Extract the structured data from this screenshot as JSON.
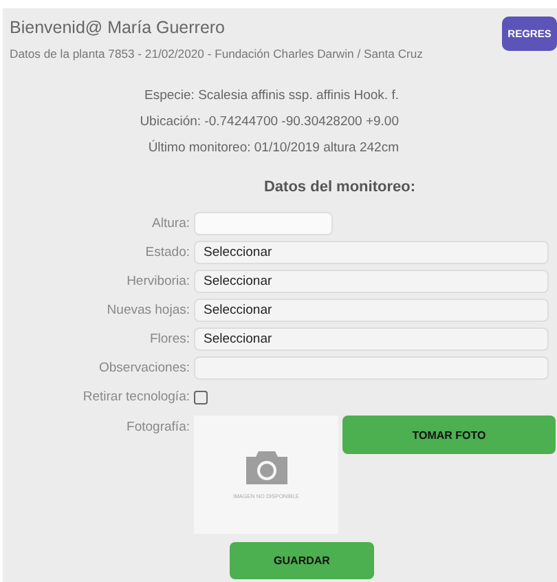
{
  "header": {
    "greeting": "Bienvenid@ María Guerrero",
    "subtitle": "Datos de la planta 7853 - 21/02/2020 - Fundación Charles Darwin / Santa Cruz",
    "back_button": "REGRES"
  },
  "plant_info": [
    "Especie: Scalesia affinis ssp. affinis Hook. f.",
    "Ubicación: -0.74244700 -90.30428200 +9.00",
    "Último monitoreo: 01/10/2019 altura 242cm"
  ],
  "section_title": "Datos del monitoreo:",
  "fields": [
    {
      "label": "Altura:",
      "kind": "text"
    },
    {
      "label": "Estado:",
      "kind": "select",
      "value": "Seleccionar"
    },
    {
      "label": "Herviboria:",
      "kind": "select",
      "value": "Seleccionar"
    },
    {
      "label": "Nuevas hojas:",
      "kind": "select",
      "value": "Seleccionar"
    },
    {
      "label": "Flores:",
      "kind": "select",
      "value": "Seleccionar"
    },
    {
      "label": "Observaciones:",
      "kind": "wide"
    },
    {
      "label": "Retirar tecnología:",
      "kind": "checkbox",
      "checked": false
    }
  ],
  "photo": {
    "label": "Fotografía:",
    "caption": "IMAGEN NO DISPONIBLE",
    "take_button": "TOMAR FOTO"
  },
  "save_button": "GUARDAR"
}
